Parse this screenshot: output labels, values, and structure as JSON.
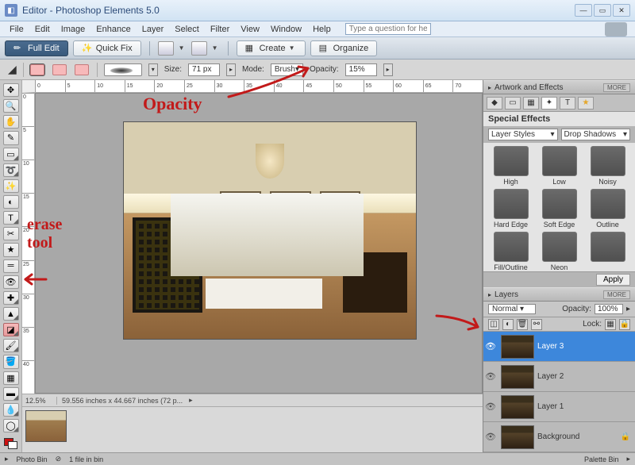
{
  "window": {
    "title": "Editor - Photoshop Elements 5.0"
  },
  "menu": {
    "items": [
      "File",
      "Edit",
      "Image",
      "Enhance",
      "Layer",
      "Select",
      "Filter",
      "View",
      "Window",
      "Help"
    ],
    "help_placeholder": "Type a question for help"
  },
  "editbar": {
    "full": "Full Edit",
    "quick": "Quick Fix",
    "create": "Create",
    "organize": "Organize"
  },
  "options": {
    "size_label": "Size:",
    "size_value": "71 px",
    "mode_label": "Mode:",
    "mode_value": "Brush",
    "opacity_label": "Opacity:",
    "opacity_value": "15%"
  },
  "ruler_h": [
    "0",
    "5",
    "10",
    "15",
    "20",
    "25",
    "30",
    "35",
    "40",
    "45",
    "50",
    "55",
    "60",
    "65",
    "70"
  ],
  "ruler_v": [
    "0",
    "5",
    "10",
    "15",
    "20",
    "25",
    "30",
    "35",
    "40"
  ],
  "status": {
    "zoom": "12.5%",
    "info": "59.556 inches x 44.667 inches (72 p..."
  },
  "bottom": {
    "photobin": "Photo Bin",
    "files": "1 file in bin",
    "palettebin": "Palette Bin"
  },
  "artwork": {
    "title": "Artwork and Effects",
    "more": "MORE",
    "se_title": "Special Effects",
    "sel1": "Layer Styles",
    "sel2": "Drop Shadows",
    "effects": [
      "High",
      "Low",
      "Noisy",
      "Hard Edge",
      "Soft Edge",
      "Outline",
      "Fill/Outline",
      "Neon",
      ""
    ],
    "apply": "Apply"
  },
  "layers": {
    "title": "Layers",
    "more": "MORE",
    "blend": "Normal",
    "opacity_label": "Opacity:",
    "opacity_value": "100%",
    "lock_label": "Lock:",
    "items": [
      {
        "name": "Layer 3",
        "selected": true
      },
      {
        "name": "Layer 2",
        "selected": false
      },
      {
        "name": "Layer 1",
        "selected": false
      },
      {
        "name": "Background",
        "selected": false,
        "locked": true
      }
    ]
  },
  "annotations": {
    "opacity": "Opacity",
    "erase": "erase\ntool"
  }
}
